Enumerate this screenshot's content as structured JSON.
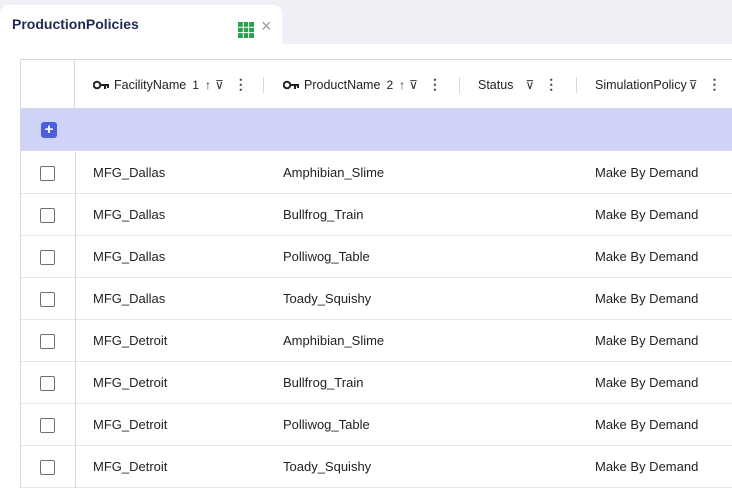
{
  "tab": {
    "title": "ProductionPolicies"
  },
  "columns": [
    {
      "label": "FacilityName",
      "key": true,
      "sort_order": "1",
      "sort_icon": "↑",
      "filter_icon": "⊽"
    },
    {
      "label": "ProductName",
      "key": true,
      "sort_order": "2",
      "sort_icon": "↑",
      "filter_icon": "⊽"
    },
    {
      "label": "Status",
      "key": false,
      "sort_order": "",
      "sort_icon": "",
      "filter_icon": "⊽"
    },
    {
      "label": "SimulationPolicy",
      "key": false,
      "sort_order": "",
      "sort_icon": "",
      "filter_icon": "⊽"
    }
  ],
  "rows": [
    {
      "facility": "MFG_Dallas",
      "product": "Amphibian_Slime",
      "status": "",
      "policy": "Make By Demand"
    },
    {
      "facility": "MFG_Dallas",
      "product": "Bullfrog_Train",
      "status": "",
      "policy": "Make By Demand"
    },
    {
      "facility": "MFG_Dallas",
      "product": "Polliwog_Table",
      "status": "",
      "policy": "Make By Demand"
    },
    {
      "facility": "MFG_Dallas",
      "product": "Toady_Squishy",
      "status": "",
      "policy": "Make By Demand"
    },
    {
      "facility": "MFG_Detroit",
      "product": "Amphibian_Slime",
      "status": "",
      "policy": "Make By Demand"
    },
    {
      "facility": "MFG_Detroit",
      "product": "Bullfrog_Train",
      "status": "",
      "policy": "Make By Demand"
    },
    {
      "facility": "MFG_Detroit",
      "product": "Polliwog_Table",
      "status": "",
      "policy": "Make By Demand"
    },
    {
      "facility": "MFG_Detroit",
      "product": "Toady_Squishy",
      "status": "",
      "policy": "Make By Demand"
    }
  ],
  "colors": {
    "accent": "#4a5fd9",
    "add_row_bg": "#cfd3f7",
    "grid_icon": "#27a34a"
  }
}
